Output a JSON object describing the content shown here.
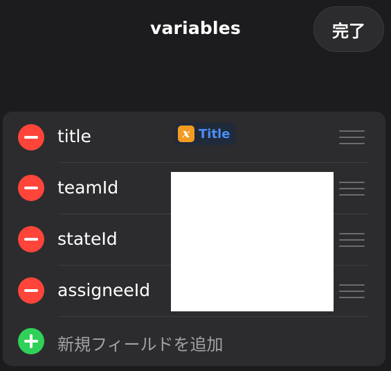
{
  "header": {
    "title": "variables",
    "done_label": "完了"
  },
  "fields": [
    {
      "label": "title",
      "value_token": {
        "icon": "x",
        "name": "Title"
      }
    },
    {
      "label": "teamId"
    },
    {
      "label": "stateId"
    },
    {
      "label": "assigneeId"
    }
  ],
  "add_field": {
    "label": "新規フィールドを追加"
  },
  "colors": {
    "background": "#1c1c1e",
    "card": "#2c2c2e",
    "remove": "#ff453a",
    "add": "#30d158",
    "variable_icon": "#f29b21",
    "variable_text": "#4a8ff7"
  }
}
